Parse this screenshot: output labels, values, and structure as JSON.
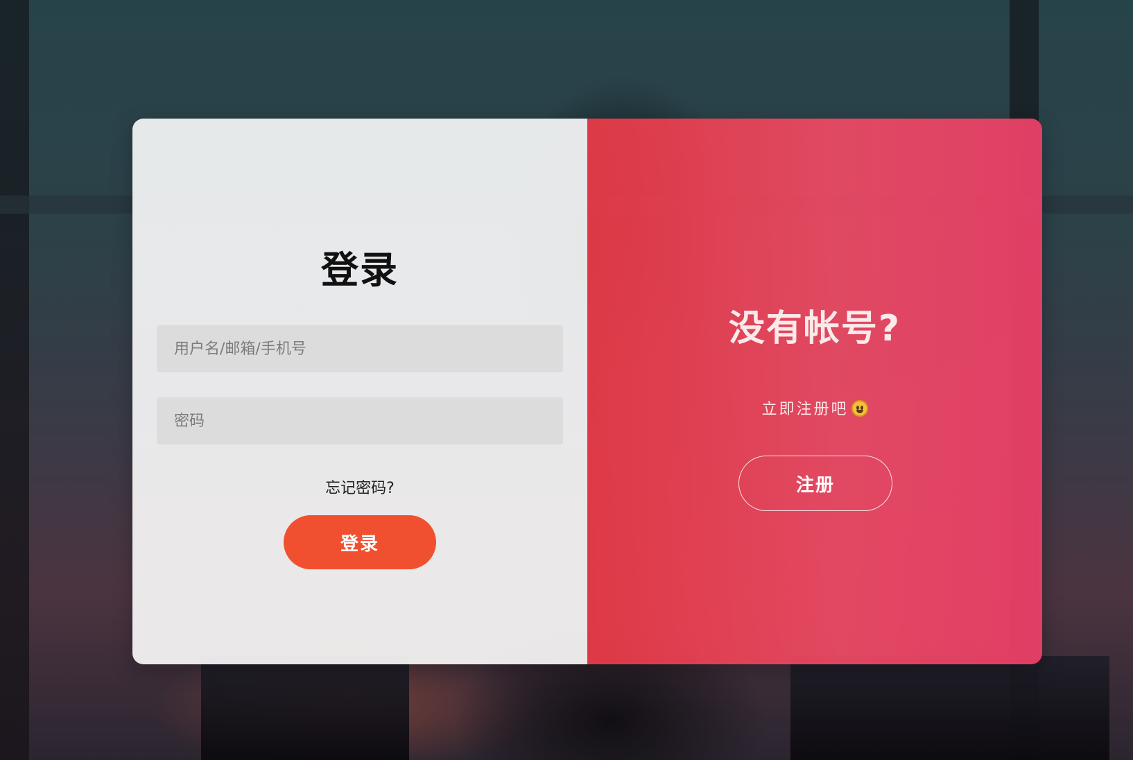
{
  "login_panel": {
    "title": "登录",
    "username_placeholder": "用户名/邮箱/手机号",
    "password_placeholder": "密码",
    "forgot_link": "忘记密码?",
    "login_button": "登录"
  },
  "register_panel": {
    "title": "没有帐号?",
    "subtitle": "立即注册吧",
    "subtitle_emoji": "grinning-face-emoji",
    "register_button": "注册"
  },
  "colors": {
    "login_button": "#f0502f",
    "register_panel": "#e8435a",
    "input_bg": "#dcdcdc"
  }
}
